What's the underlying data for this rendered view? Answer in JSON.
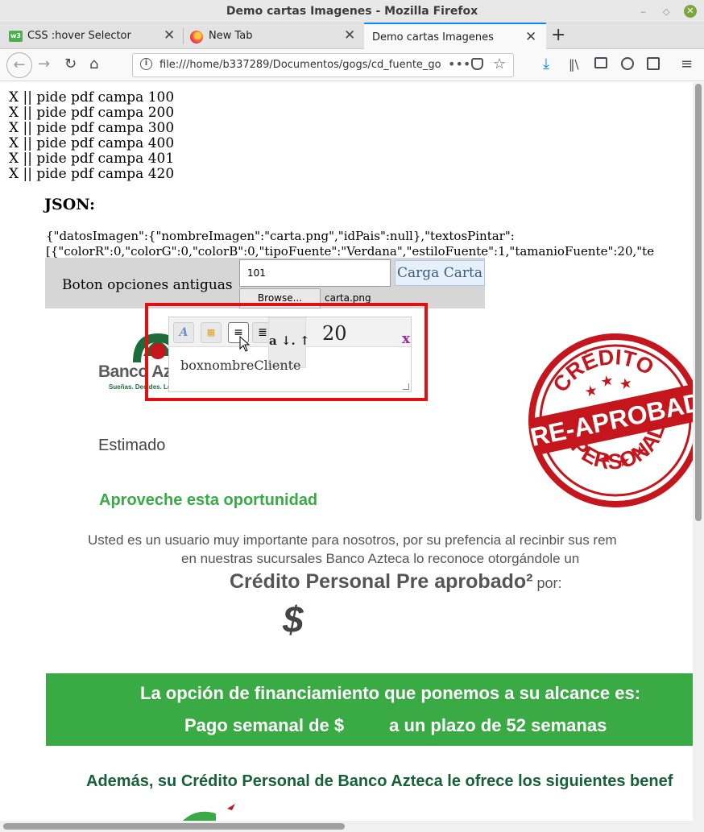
{
  "window": {
    "title": "Demo cartas Imagenes - Mozilla Firefox"
  },
  "tabs": [
    {
      "label": "CSS :hover Selector",
      "icon": "w3schools-icon"
    },
    {
      "label": "New Tab",
      "icon": "firefox-icon"
    },
    {
      "label": "Demo cartas Imagenes",
      "active": true
    }
  ],
  "urlbar": {
    "url": "file:///home/b337289/Documentos/gogs/cd_fuente_go/apirest"
  },
  "page": {
    "campa_links": [
      "X || pide pdf campa 100",
      "X || pide pdf campa 200",
      "X || pide pdf campa 300",
      "X || pide pdf campa 400",
      "X || pide pdf campa 401",
      "X || pide pdf campa 420"
    ],
    "json_heading": "JSON:",
    "json_line1": "{\"datosImagen\":{\"nombreImagen\":\"carta.png\",\"idPais\":null},\"textosPintar\":",
    "json_line2": "[{\"colorR\":0,\"colorG\":0,\"colorB\":0,\"tipoFuente\":\"Verdana\",\"estiloFuente\":1,\"tamanioFuente\":20,\"te",
    "options_label": "Boton opciones antiguas",
    "campa_input_value": "101",
    "load_button": "Carga Carta",
    "browse_button": "Browse...",
    "file_name": "carta.png"
  },
  "letter": {
    "logo_name": "Banco Azteca",
    "logo_tagline": "Sueñas. Decides. Logras.",
    "stamp_top": "CRÉDITO",
    "stamp_middle": "PRE-APROBADO",
    "stamp_bottom": "PERSONAL",
    "greeting": "Estimado",
    "headline": "Aproveche esta oportunidad",
    "body_line1": "Usted es un usuario muy importante para nosotros, por su prefencia al recinbir sus rem",
    "body_line2": "en nuestras sucursales Banco Azteca lo reconoce otorgándole un",
    "credit_title": "Crédito Personal Pre aprobado²",
    "credit_por": " por:",
    "currency": "$",
    "band_line1": "La opción de financiamiento que ponemos a su alcance es:",
    "band_line2a": "Pago semanal de $",
    "band_line2b": "a un plazo de 52 semanas",
    "benefits_line": "Además, su Crédito Personal de Banco Azteca le ofrece los siguientes benef"
  },
  "editor": {
    "font_size": "20",
    "size_arrows": "a ↓. ↑",
    "close": "x",
    "text": "boxnombreCliente"
  },
  "colors": {
    "brand_green": "#3aaa45",
    "dark_green": "#17603a",
    "stamp_red": "#c4161c",
    "highlight_red": "#e01010"
  }
}
